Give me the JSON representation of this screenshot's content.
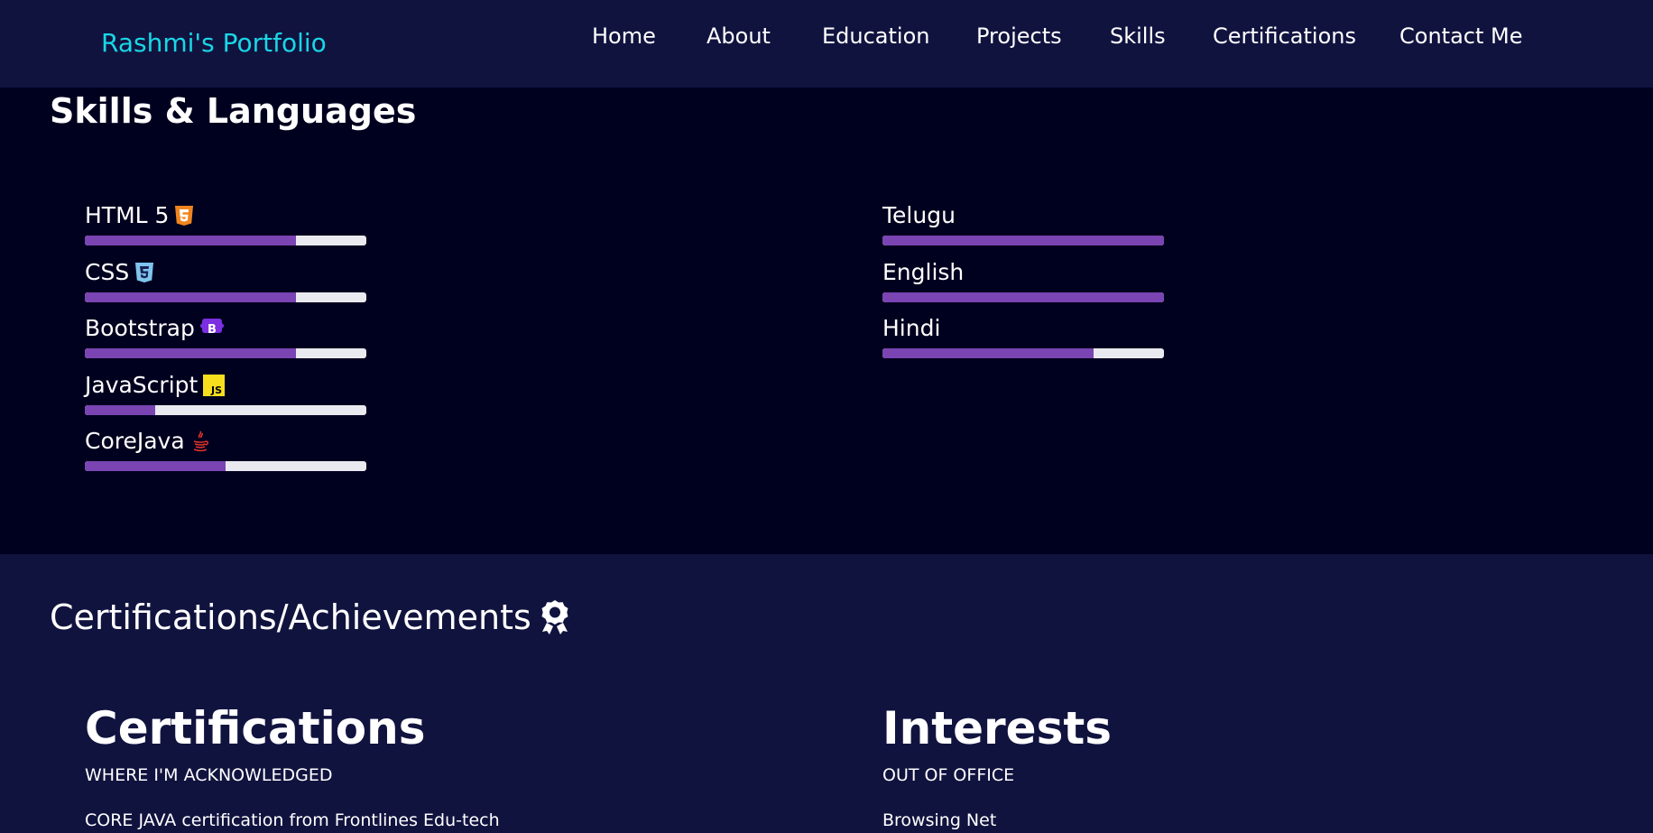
{
  "navbar": {
    "brand": "Rashmi's Portfolio",
    "items": [
      {
        "label": "Home"
      },
      {
        "label": "About"
      },
      {
        "label": "Education"
      },
      {
        "label": "Projects"
      },
      {
        "label": "Skills"
      },
      {
        "label": "Certifications"
      },
      {
        "label": "Contact Me"
      }
    ]
  },
  "skills_section": {
    "title": "Skills & Languages",
    "skills": [
      {
        "label": "HTML 5",
        "icon": "html5-icon",
        "level": 0.75
      },
      {
        "label": "CSS",
        "icon": "css3-icon",
        "level": 0.75
      },
      {
        "label": "Bootstrap",
        "icon": "bootstrap-icon",
        "level": 0.75
      },
      {
        "label": "JavaScript",
        "icon": "javascript-icon",
        "level": 0.25
      },
      {
        "label": "CoreJava",
        "icon": "java-icon",
        "level": 0.5
      }
    ],
    "languages": [
      {
        "label": "Telugu",
        "level": 1.0
      },
      {
        "label": "English",
        "level": 1.0
      },
      {
        "label": "Hindi",
        "level": 0.75
      }
    ]
  },
  "certifications_section": {
    "title": "Certifications/Achievements",
    "title_icon": "award-icon",
    "certifications": {
      "heading": "Certifications",
      "subheading": "WHERE I'M ACKNOWLEDGED",
      "items": [
        "CORE JAVA certification from Frontlines Edu-tech"
      ]
    },
    "interests": {
      "heading": "Interests",
      "subheading": "OUT OF OFFICE",
      "items": [
        "Browsing Net"
      ]
    }
  },
  "colors": {
    "page_bg": "#00001f",
    "navbar_bg": "#11133f",
    "brand": "#19d7e6",
    "bar_fill": "#7a44b3",
    "bar_track": "#e8eaef"
  }
}
